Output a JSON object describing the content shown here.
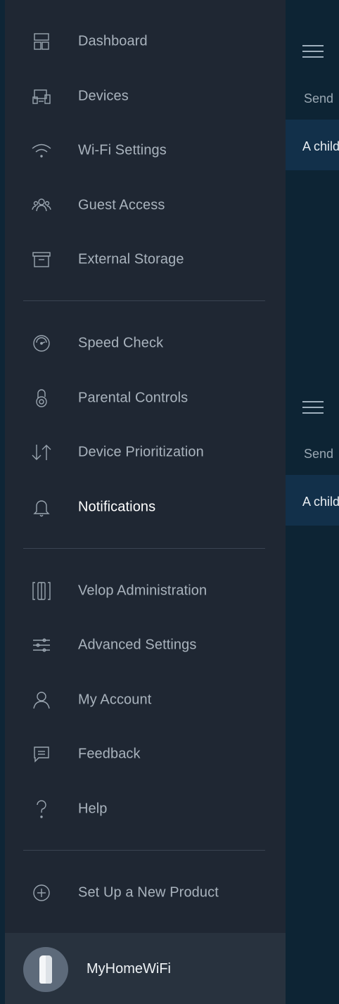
{
  "background": {
    "sections": [
      {
        "send_text": "Send",
        "child_text": "A child"
      },
      {
        "send_text": "Send",
        "child_text": "A child"
      }
    ]
  },
  "drawer": {
    "groups": [
      [
        {
          "label": "Dashboard",
          "icon": "dashboard-icon"
        },
        {
          "label": "Devices",
          "icon": "devices-icon"
        },
        {
          "label": "Wi-Fi Settings",
          "icon": "wifi-icon"
        },
        {
          "label": "Guest Access",
          "icon": "guest-icon"
        },
        {
          "label": "External Storage",
          "icon": "storage-icon"
        }
      ],
      [
        {
          "label": "Speed Check",
          "icon": "speedometer-icon"
        },
        {
          "label": "Parental Controls",
          "icon": "lock-icon"
        },
        {
          "label": "Device Prioritization",
          "icon": "priority-arrows-icon"
        },
        {
          "label": "Notifications",
          "icon": "bell-icon",
          "active": true
        }
      ],
      [
        {
          "label": "Velop Administration",
          "icon": "velop-node-icon"
        },
        {
          "label": "Advanced Settings",
          "icon": "sliders-icon"
        },
        {
          "label": "My Account",
          "icon": "user-icon"
        },
        {
          "label": "Feedback",
          "icon": "chat-icon"
        },
        {
          "label": "Help",
          "icon": "question-icon"
        }
      ],
      [
        {
          "label": "Set Up a New Product",
          "icon": "add-circle-icon"
        }
      ]
    ],
    "footer": {
      "network_name": "MyHomeWiFi"
    }
  },
  "colors": {
    "drawer_bg": "#1f2733",
    "label": "#a9b3bd",
    "active_label": "#ffffff",
    "icon": "#9aa5b0"
  }
}
